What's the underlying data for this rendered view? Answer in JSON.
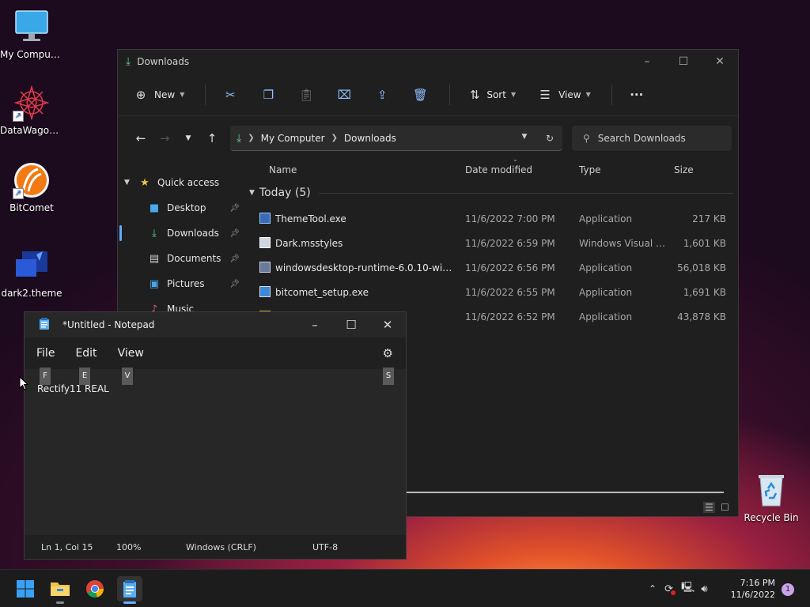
{
  "desktop": {
    "icons": [
      {
        "label": "My Computer"
      },
      {
        "label": "DataWagon..."
      },
      {
        "label": "BitComet"
      },
      {
        "label": "dark2.theme"
      },
      {
        "label": "Recycle Bin"
      }
    ]
  },
  "explorer": {
    "title": "Downloads",
    "toolbar": {
      "new_label": "New",
      "sort_label": "Sort",
      "view_label": "View"
    },
    "address": {
      "root": "My Computer",
      "current": "Downloads"
    },
    "search_placeholder": "Search Downloads",
    "nav": {
      "quick_access": "Quick access",
      "items": [
        "Desktop",
        "Downloads",
        "Documents",
        "Pictures",
        "Music"
      ]
    },
    "columns": {
      "name": "Name",
      "date": "Date modified",
      "type": "Type",
      "size": "Size"
    },
    "group_label": "Today (5)",
    "files": [
      {
        "name": "ThemeTool.exe",
        "date": "11/6/2022 7:00 PM",
        "type": "Application",
        "size": "217 KB"
      },
      {
        "name": "Dark.msstyles",
        "date": "11/6/2022 6:59 PM",
        "type": "Windows Visual St...",
        "size": "1,601 KB"
      },
      {
        "name": "windowsdesktop-runtime-6.0.10-win-x6...",
        "date": "11/6/2022 6:56 PM",
        "type": "Application",
        "size": "56,018 KB"
      },
      {
        "name": "bitcomet_setup.exe",
        "date": "11/6/2022 6:55 PM",
        "type": "Application",
        "size": "1,691 KB"
      },
      {
        "name": "",
        "date": "11/6/2022 6:52 PM",
        "type": "Application",
        "size": "43,878 KB"
      }
    ]
  },
  "notepad": {
    "title": "*Untitled - Notepad",
    "menu": {
      "file": "File",
      "edit": "Edit",
      "view": "View"
    },
    "keytips": {
      "file": "F",
      "edit": "E",
      "view": "V",
      "settings": "S"
    },
    "content": "Rectify11 REAL",
    "status": {
      "position": "Ln 1, Col 15",
      "zoom": "100%",
      "line_ending": "Windows (CRLF)",
      "encoding": "UTF-8"
    }
  },
  "taskbar": {
    "time": "7:16 PM",
    "date": "11/6/2022",
    "notification_count": "1"
  }
}
